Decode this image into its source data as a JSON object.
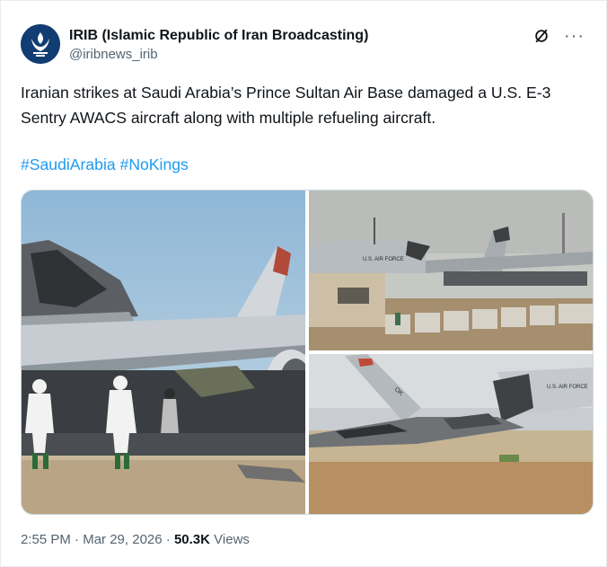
{
  "post": {
    "author": {
      "display_name": "IRIB (Islamic Republic of Iran Broadcasting)",
      "handle": "@iribnews_irib"
    },
    "text": "Iranian strikes at Saudi Arabia’s Prince Sultan Air Base damaged a U.S. E-3 Sentry AWACS aircraft along with multiple refueling aircraft.",
    "hashtags": [
      "#SaudiArabia",
      "#NoKings"
    ],
    "media": {
      "photos": [
        {
          "id": "photo-1",
          "tail_text": ""
        },
        {
          "id": "photo-2",
          "fuselage_text": "U.S. AIR FORCE"
        },
        {
          "id": "photo-3",
          "fuselage_text": "U.S. AIR FORCE"
        }
      ]
    },
    "time": "2:55 PM",
    "date": "Mar 29, 2026",
    "separator": "·",
    "views_count": "50.3K",
    "views_label": "Views"
  },
  "icons": {
    "avatar": "irib-logo",
    "grok": "grok-icon",
    "more": "more-icon"
  },
  "colors": {
    "link": "#1d9bf0",
    "secondary_text": "#536471",
    "primary_text": "#0f1419"
  }
}
